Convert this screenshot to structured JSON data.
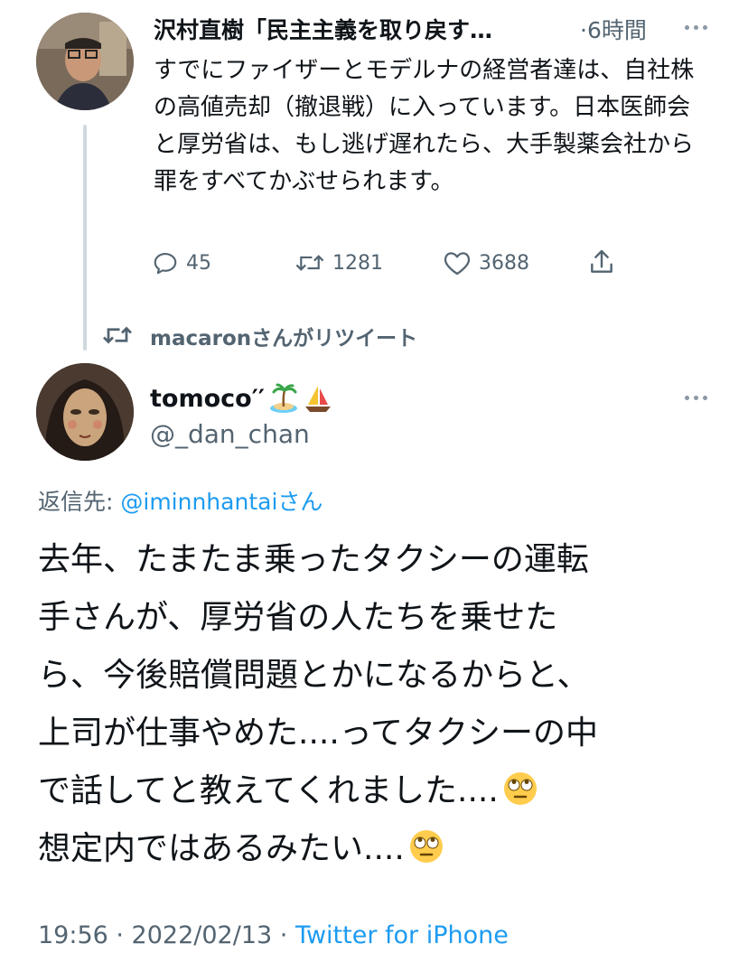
{
  "tweet1": {
    "display_name": "沢村直樹「民主主義を取り戻す…",
    "time": "·6時間",
    "text": "すでにファイザーとモデルナの経営者達は、自社株の高値売却（撤退戦）に入っています。日本医師会と厚労省は、もし逃げ遅れたら、大手製薬会社から罪をすべてかぶせられます。",
    "reply_count": "45",
    "retweet_count": "1281",
    "like_count": "3688"
  },
  "retweet_banner": {
    "text": "macaronさんがリツイート"
  },
  "tweet2": {
    "display_name": "tomoco′′",
    "emoji_icons": [
      "desert-island-icon",
      "sailboat-icon"
    ],
    "handle": "@_dan_chan",
    "reply_to_prefix": "返信先: ",
    "reply_to_handle": "@iminnhantai",
    "reply_to_suffix": "さん",
    "text_lines": [
      "去年、たまたま乗ったタクシーの運転",
      "手さんが、厚労省の人たちを乗せた",
      "ら、今後賠償問題とかになるからと、",
      "上司が仕事やめた....ってタクシーの中",
      "で話してと教えてくれました....",
      "想定内ではあるみたい...."
    ],
    "line_emojis": [
      "",
      "",
      "",
      "",
      "face-with-rolling-eyes-icon",
      "face-with-rolling-eyes-icon"
    ],
    "meta_time": "19:56 · 2022/02/13 · ",
    "meta_source": "Twitter for iPhone"
  },
  "colors": {
    "link": "#1d9bf0",
    "muted": "#536471",
    "thread_line": "#cfd9de"
  }
}
